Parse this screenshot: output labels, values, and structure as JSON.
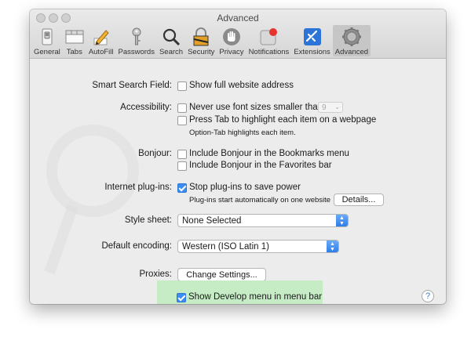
{
  "window": {
    "title": "Advanced"
  },
  "toolbar": {
    "items": [
      {
        "label": "General",
        "icon": "switch-icon"
      },
      {
        "label": "Tabs",
        "icon": "tabs-icon"
      },
      {
        "label": "AutoFill",
        "icon": "pencil-icon"
      },
      {
        "label": "Passwords",
        "icon": "key-icon"
      },
      {
        "label": "Search",
        "icon": "magnifier-icon"
      },
      {
        "label": "Security",
        "icon": "padlock-icon"
      },
      {
        "label": "Privacy",
        "icon": "hand-icon"
      },
      {
        "label": "Notifications",
        "icon": "notification-icon"
      },
      {
        "label": "Extensions",
        "icon": "puzzle-icon"
      },
      {
        "label": "Advanced",
        "icon": "gear-icon"
      }
    ],
    "selected": "Advanced"
  },
  "smart_search": {
    "label": "Smart Search Field:",
    "option": "Show full website address",
    "checked": false
  },
  "accessibility": {
    "label": "Accessibility:",
    "font_option": "Never use font sizes smaller than",
    "font_size": "9",
    "tab_option": "Press Tab to highlight each item on a webpage",
    "tab_note": "Option-Tab highlights each item."
  },
  "bonjour": {
    "label": "Bonjour:",
    "bookmarks_option": "Include Bonjour in the Bookmarks menu",
    "favorites_option": "Include Bonjour in the Favorites bar"
  },
  "plugins": {
    "label": "Internet plug-ins:",
    "option": "Stop plug-ins to save power",
    "checked": true,
    "note": "Plug-ins start automatically on one website",
    "details_button": "Details..."
  },
  "style_sheet": {
    "label": "Style sheet:",
    "value": "None Selected"
  },
  "encoding": {
    "label": "Default encoding:",
    "value": "Western (ISO Latin 1)"
  },
  "proxies": {
    "label": "Proxies:",
    "button": "Change Settings..."
  },
  "develop": {
    "option": "Show Develop menu in menu bar",
    "checked": true
  },
  "help": {
    "label": "?"
  },
  "colors": {
    "accent": "#3b8df2",
    "highlight": "#c5ecc5",
    "selected_tab": "#c6c6c6"
  }
}
